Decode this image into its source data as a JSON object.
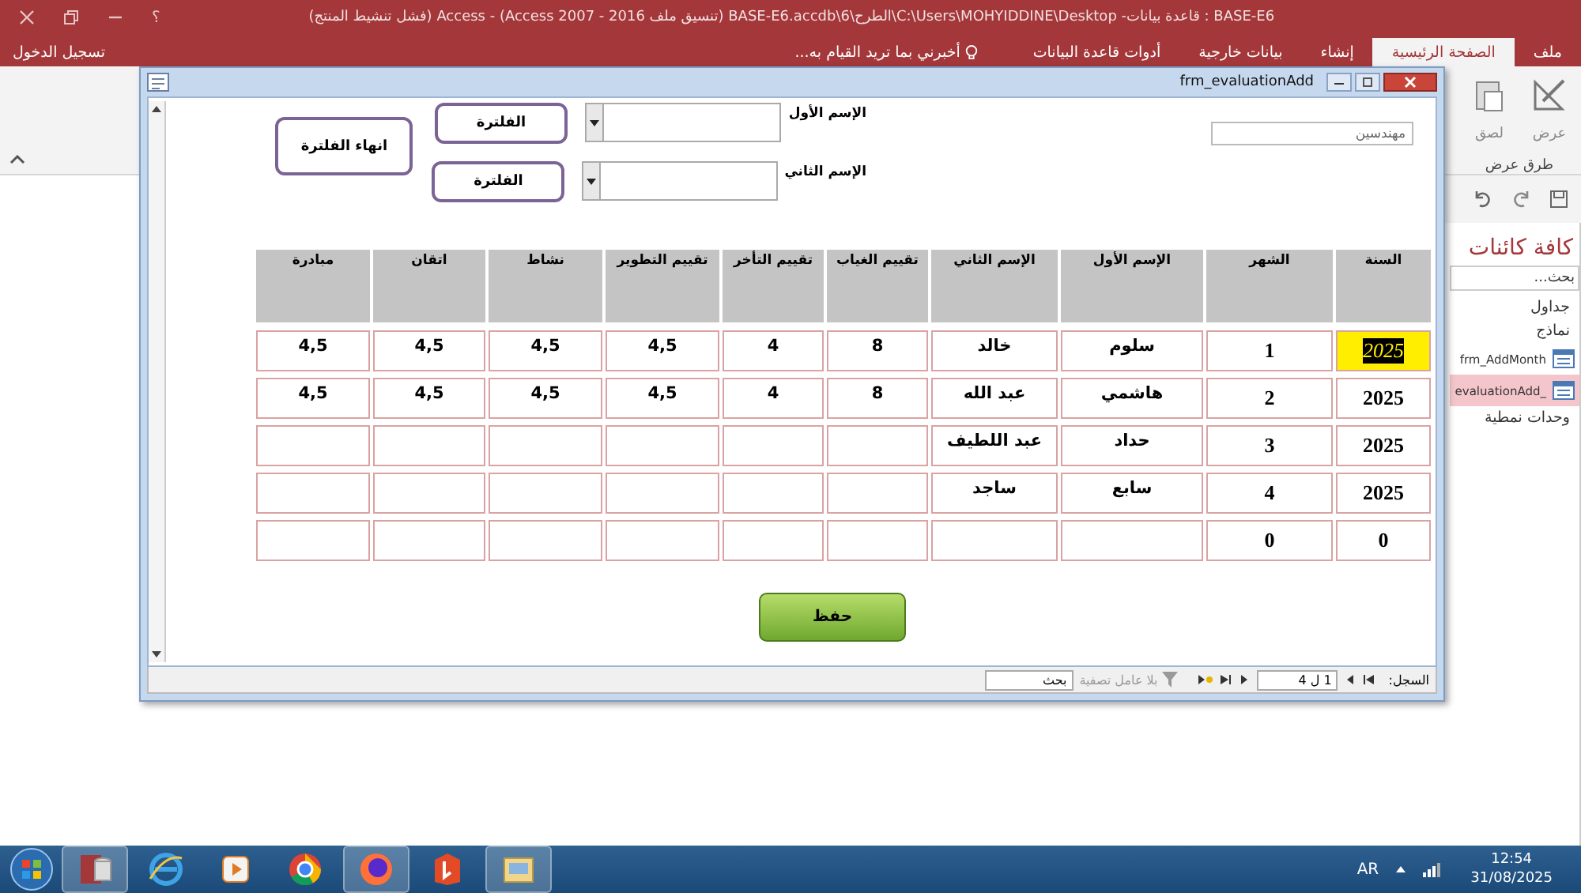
{
  "window": {
    "title": "BASE-E6 : قاعدة بيانات- C:\\Users\\MOHYIDDINE\\Desktop\\الطرح\\6\\BASE-E6.accdb (تنسيق ملف Access 2007 - 2016) - Access (فشل تنشيط المنتج)",
    "help": "؟"
  },
  "ribbon_tabs": [
    {
      "label": "ملف",
      "selected": false
    },
    {
      "label": "الصفحة الرئيسية",
      "selected": true
    },
    {
      "label": "إنشاء",
      "selected": false
    },
    {
      "label": "بيانات خارجية",
      "selected": false
    },
    {
      "label": "أدوات قاعدة البيانات",
      "selected": false
    }
  ],
  "tell_me": "أخبرني بما تريد القيام به...",
  "sign_in": "تسجيل الدخول",
  "ribbon": {
    "buttons": [
      "عرض",
      "لصق"
    ],
    "group_label": "طرق عرض"
  },
  "nav_pane": {
    "title": "كافة كائنات",
    "search": {
      "placeholder": "بحث..."
    },
    "groups": [
      {
        "label": "جداول"
      },
      {
        "label": "نماذج",
        "children": [
          {
            "label": "frm_AddMonth",
            "selected": false
          },
          {
            "label": "_evaluationAdd",
            "selected": true
          }
        ]
      },
      {
        "label": "وحدات نمطية"
      }
    ]
  },
  "form": {
    "title": "frm_evaluationAdd",
    "category_field": {
      "value": "مهندسين"
    },
    "filters": [
      {
        "label": "الإسم الأول",
        "button": "الفلترة"
      },
      {
        "label": "الإسم الثاني",
        "button": "الفلترة"
      }
    ],
    "end_filter_button": "انهاء الفلترة",
    "table": {
      "columns": [
        "السنة",
        "الشهر",
        "الإسم الأول",
        "الإسم الثاني",
        "تقييم الغياب",
        "تقييم التأخر",
        "تقييم التطوير",
        "نشاط",
        "اتقان",
        "مبادرة"
      ],
      "rows": [
        {
          "selected": true,
          "cells": [
            "2025",
            "1",
            "سلوم",
            "خالد",
            "8",
            "4",
            "4,5",
            "4,5",
            "4,5",
            "4,5"
          ]
        },
        {
          "selected": false,
          "cells": [
            "2025",
            "2",
            "هاشمي",
            "عبد الله",
            "8",
            "4",
            "4,5",
            "4,5",
            "4,5",
            "4,5"
          ]
        },
        {
          "selected": false,
          "cells": [
            "2025",
            "3",
            "حداد",
            "عبد اللطيف"
          ]
        },
        {
          "selected": false,
          "cells": [
            "2025",
            "4",
            "سابع",
            "ساجد"
          ]
        },
        {
          "selected": false,
          "cells": [
            "0",
            "0"
          ]
        }
      ]
    },
    "save_button": "حفظ",
    "record_nav": {
      "label": "السجل:",
      "position": "1 ل 4",
      "filter": "بلا عامل تصفية",
      "search": "بحث"
    }
  },
  "taskbar": {
    "language": "AR",
    "time": "12:54",
    "date": "31/08/2025"
  }
}
